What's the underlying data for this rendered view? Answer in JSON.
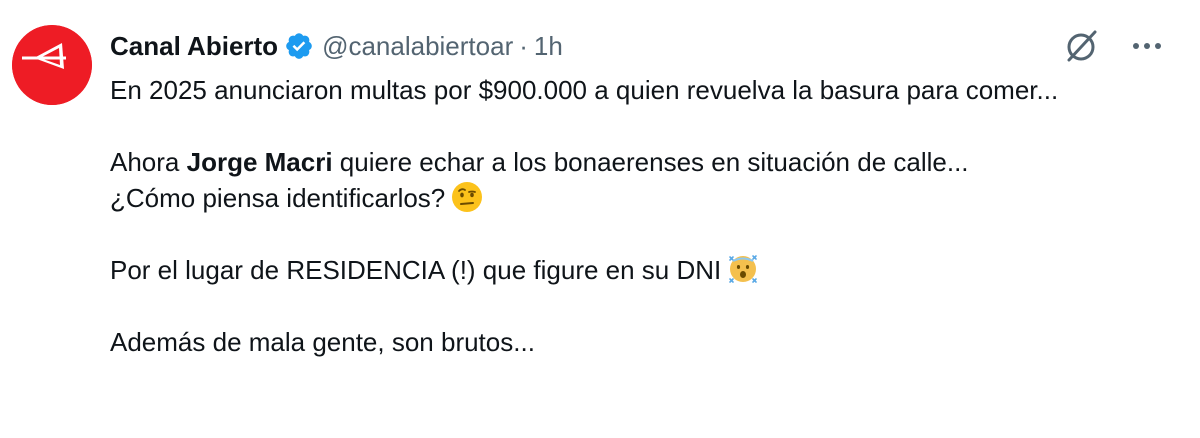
{
  "account": {
    "display_name": "Canal Abierto",
    "handle": "@canalabiertoar",
    "separator": "·",
    "time": "1h"
  },
  "icons": {
    "avatar": "canal-abierto-logo",
    "verified": "verified-badge-icon",
    "grok": "grok-icon",
    "more": "more-icon",
    "emoji_1": "raised-eyebrow-face-emoji",
    "emoji_2": "cold-face-emoji"
  },
  "colors": {
    "avatar_red": "#ee1c25",
    "verified_blue": "#1d9bf0",
    "text_primary": "#0f1419",
    "text_secondary": "#536471"
  },
  "tweet": {
    "p1": "En 2025 anunciaron multas por $900.000 a quien revuelva la basura para comer...",
    "p2_prefix": "Ahora ",
    "p2_bold": "Jorge Macri",
    "p2_suffix": " quiere echar a los bonaerenses en situación de calle...",
    "p2_line2": "¿Cómo piensa identificarlos?",
    "p3": "Por el lugar de RESIDENCIA (!) que figure en su DNI",
    "p4": "Además de mala gente, son brutos..."
  }
}
